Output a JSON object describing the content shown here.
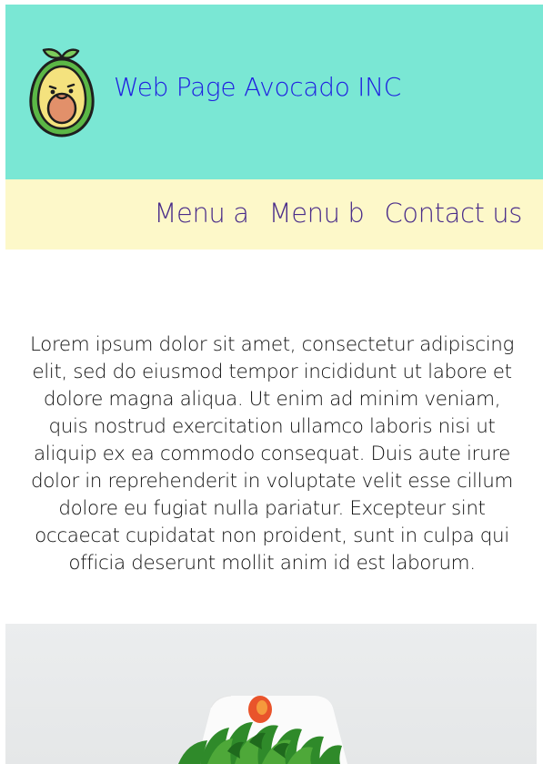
{
  "header": {
    "title": "Web Page Avocado INC",
    "logo_icon": "avocado-mascot-icon",
    "background": "#7ae7d4",
    "title_color": "#1f1fe0"
  },
  "nav": {
    "background": "#fdf8c9",
    "text_color": "#4a2d8a",
    "items": [
      {
        "label": "Menu a"
      },
      {
        "label": "Menu b"
      },
      {
        "label": "Contact us"
      }
    ]
  },
  "main": {
    "intro_text": "Lorem ipsum dolor sit amet, consectetur adipiscing elit, sed do eiusmod tempor incididunt ut labore et dolore magna aliqua. Ut enim ad minim veniam, quis nostrud exercitation ullamco laboris nisi ut aliquip ex ea commodo consequat. Duis aute irure dolor in reprehenderit in voluptate velit esse cillum dolore eu fugiat nulla pariatur. Excepteur sint occaecat cupidatat non proident, sunt in culpa qui officia deserunt mollit anim id est laborum."
  },
  "hero": {
    "image_subject": "salad-bowl-photo"
  }
}
